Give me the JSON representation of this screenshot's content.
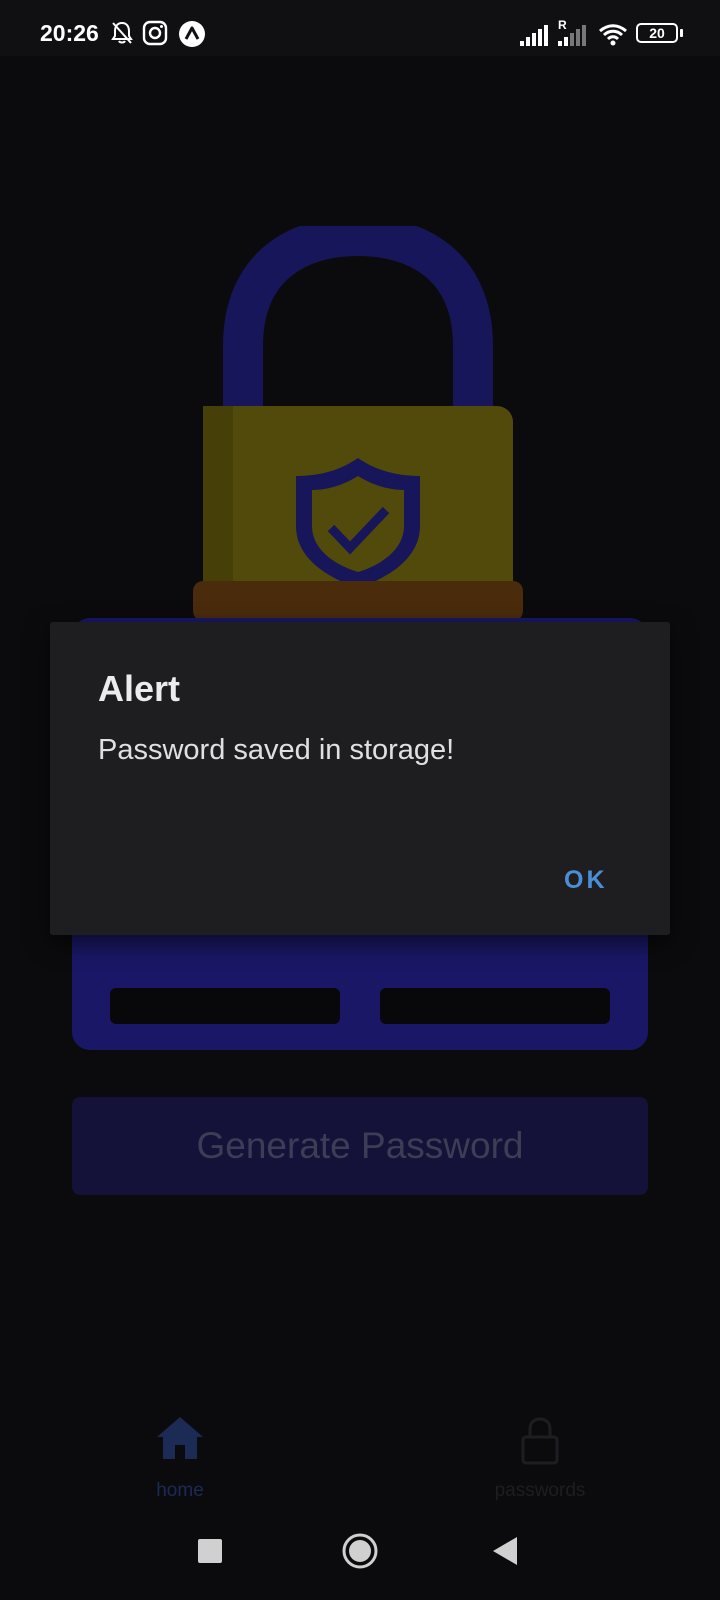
{
  "status_bar": {
    "time": "20:26",
    "battery": "20",
    "roaming_label": "R",
    "icons": [
      "notifications-muted-icon",
      "instagram-icon",
      "app-logo-icon",
      "signal-icon",
      "signal-roaming-icon",
      "wifi-icon",
      "battery-icon"
    ]
  },
  "app": {
    "generate_button_label": "Generate Password"
  },
  "dialog": {
    "title": "Alert",
    "message": "Password saved in storage!",
    "ok_label": "OK"
  },
  "bottom_nav": {
    "items": [
      {
        "label": "home",
        "icon": "home-icon",
        "active": true,
        "color": "#1b2b55"
      },
      {
        "label": "passwords",
        "icon": "lock-icon",
        "active": false,
        "color": "#1e1e22"
      }
    ]
  },
  "system_nav": {
    "icons": [
      "recents-icon",
      "home-circle-icon",
      "back-icon"
    ]
  },
  "colors": {
    "background": "#0b0b0d",
    "card": "#1a1866",
    "dialog": "#1e1e20",
    "accent": "#4a8fd6"
  }
}
